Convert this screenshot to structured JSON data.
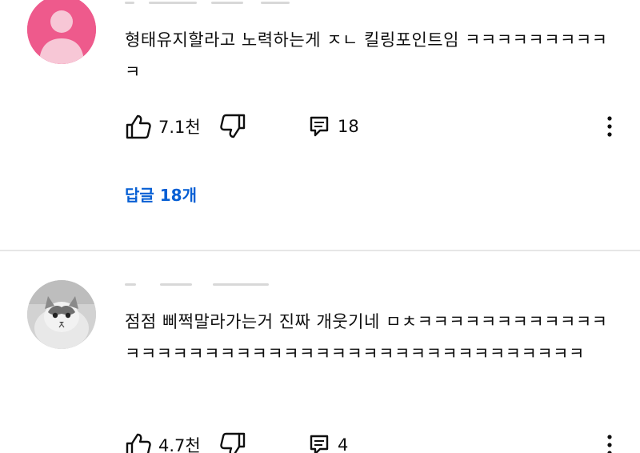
{
  "comments": [
    {
      "text": "형태유지할라고 노력하는게 ㅈㄴ 킬링포인트임 ㅋㅋㅋㅋㅋㅋㅋㅋㅋㅋ",
      "likes": "7.1천",
      "reply_count": "18",
      "replies_link": "답글 18개",
      "avatar_color": "#ee5a8c"
    },
    {
      "text": "점점 삐쩍말라가는거 진짜 개웃기네 ㅁㅊㅋㅋㅋㅋㅋㅋㅋㅋㅋㅋㅋㅋㅋㅋㅋㅋㅋㅋㅋㅋㅋㅋㅋㅋㅋㅋㅋㅋㅋㅋㅋㅋㅋㅋㅋㅋㅋㅋㅋㅋㅋ",
      "likes": "4.7천",
      "reply_count": "4"
    }
  ],
  "colors": {
    "link": "#065fd4",
    "text": "#0f0f0f",
    "divider": "#e6e6e6"
  },
  "icons": [
    "like-icon",
    "dislike-icon",
    "reply-icon",
    "more-icon",
    "default-avatar-icon"
  ]
}
